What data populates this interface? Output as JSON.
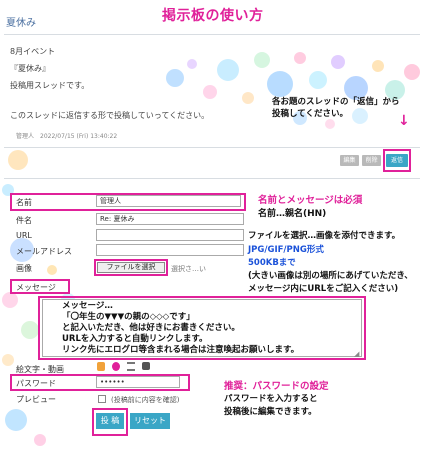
{
  "header": {
    "title": "夏休み",
    "headline": "掲示板の使い方"
  },
  "post": {
    "lines": [
      "8月イベント",
      "『夏休み』",
      "投稿用スレッドです。"
    ],
    "message": "このスレッドに返信する形で投稿していってください。",
    "meta": "管理人　2022/07/15 (Fri) 13:40:22",
    "buttons": {
      "edit": "編集",
      "delete": "削除",
      "reply": "返信"
    }
  },
  "notes": {
    "reply_line1": "各お題のスレッドの「返信」から",
    "reply_line2": "投稿してください。",
    "name_title": "名前とメッセージは必須",
    "name_sub": "名前…親名(HN)",
    "file_line1": "ファイルを選択…画像を添付できます。",
    "file_line2": "JPG/GIF/PNG形式",
    "file_line3": "500KBまで",
    "file_line4": "(大きい画像は別の場所にあげていただき、",
    "file_line5": "メッセージ内にURLをご記入ください)",
    "msg_line1": "メッセージ…",
    "msg_line2": "「〇年生の▼▼▼の親の◇◇◇です」",
    "msg_line3": "と記入いただき、他は好きにお書きください。",
    "msg_line4": "URLを入力すると自動リンクします。",
    "msg_line5": "リンク先にエログロ等含まれる場合は注意喚起お願いします。",
    "pw_title": "推奨：パスワードの設定",
    "pw_line1": "パスワードを入力すると",
    "pw_line2": "投稿後に編集できます。"
  },
  "form": {
    "name_label": "名前",
    "name_value": "管理人",
    "subject_label": "件名",
    "subject_value": "Re: 夏休み",
    "url_label": "URL",
    "email_label": "メールアドレス",
    "image_label": "画像",
    "file_button": "ファイルを選択",
    "file_status": "選択さ…い",
    "message_label": "メッセージ",
    "emoji_label": "絵文字・動画",
    "password_label": "パスワード",
    "password_value": "••••••",
    "preview_label": "プレビュー",
    "preview_text": "(投稿前に内容を確認)",
    "submit": "投 稿",
    "reset": "リセット"
  },
  "colors": {
    "accent_pink": "#e0219a",
    "note_blue": "#1b52d9",
    "button_teal": "#3aa6c6"
  }
}
